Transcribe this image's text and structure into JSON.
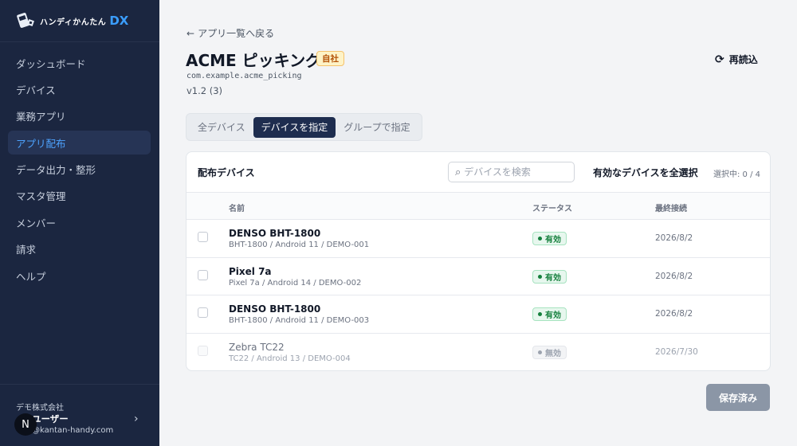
{
  "brand": {
    "name": "ハンディかんたん",
    "suffix": "DX"
  },
  "sidebar": {
    "items": [
      {
        "label": "ダッシュボード"
      },
      {
        "label": "デバイス"
      },
      {
        "label": "業務アプリ"
      },
      {
        "label": "アプリ配布",
        "active": true
      },
      {
        "label": "データ出力・整形"
      },
      {
        "label": "マスタ管理"
      },
      {
        "label": "メンバー"
      },
      {
        "label": "請求"
      },
      {
        "label": "ヘルプ"
      }
    ],
    "footer": {
      "company": "デモ株式会社",
      "user": "ユーザー",
      "email": "@kantan-handy.com",
      "avatar_initial": "N"
    }
  },
  "header": {
    "back_label": "アプリ一覧へ戻る",
    "title": "ACME ピッキング",
    "badge": "自社",
    "package": "com.example.acme_picking",
    "version": "v1.2 (3)",
    "reload_label": "再読込"
  },
  "tabs": [
    {
      "label": "全デバイス"
    },
    {
      "label": "デバイスを指定",
      "active": true
    },
    {
      "label": "グループで指定"
    }
  ],
  "devices_panel": {
    "title": "配布デバイス",
    "search_placeholder": "デバイスを検索",
    "select_all_label": "有効なデバイスを全選択",
    "selection_count": "選択中: 0 / 4",
    "columns": {
      "name": "名前",
      "status": "ステータス",
      "last_seen": "最終接続"
    },
    "rows": [
      {
        "name": "DENSO BHT-1800",
        "sub": "BHT-1800 / Android 11 / DEMO-001",
        "status": "有効",
        "last_seen": "2026/8/2"
      },
      {
        "name": "Pixel 7a",
        "sub": "Pixel 7a / Android 14 / DEMO-002",
        "status": "有効",
        "last_seen": "2026/8/2"
      },
      {
        "name": "DENSO BHT-1800",
        "sub": "BHT-1800 / Android 11 / DEMO-003",
        "status": "有効",
        "last_seen": "2026/8/2"
      },
      {
        "name": "Zebra TC22",
        "sub": "TC22 / Android 13 / DEMO-004",
        "status": "無効",
        "last_seen": "2026/7/30"
      }
    ]
  },
  "save_label": "保存済み",
  "colors": {
    "sidebar_bg": "#1b2640",
    "accent": "#4da3ff",
    "active_tab": "#1e2d4f",
    "status_ok": "#15803d"
  }
}
